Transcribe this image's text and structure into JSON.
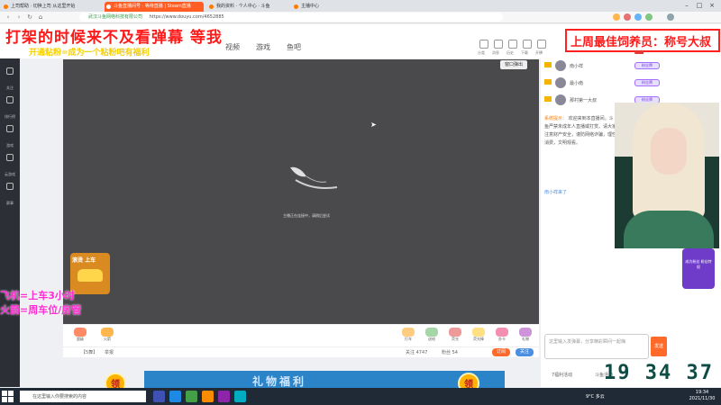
{
  "browser": {
    "tabs": [
      {
        "label": "上司帮助 · 切换上司 从这里开始",
        "active": false
      },
      {
        "label": "斗鱼直播间号 · 等待直播 | Steam直播",
        "active": true
      },
      {
        "label": "我的资料 · 个人中心 · 斗鱼",
        "active": false
      },
      {
        "label": "主播中心",
        "active": false
      }
    ],
    "url_secure_label": "武汉斗鱼网络科技有限公司",
    "url": "https://www.douyu.com/4652885"
  },
  "overlay": {
    "banner_main": "打架的时候来不及看弹幕 等我",
    "banner_sub": "开通粘粉=成为一个粘粉吧有福利",
    "top_right": "上周最佳饲养员：称号大叔",
    "side_line1": "飞机=上车3小时",
    "side_line2": "火箭=周车位/房管"
  },
  "site": {
    "nav": [
      "视频",
      "游戏",
      "鱼吧"
    ],
    "header_icons": [
      "分类",
      "消息",
      "历史",
      "下载",
      "开播"
    ]
  },
  "sidebar": {
    "items": [
      "关注",
      "排行榜",
      "游戏",
      "云游戏",
      "赛事"
    ]
  },
  "player": {
    "popout_label": "窗口弹出",
    "loading_text": "主播正在连接中，请稍后尝试"
  },
  "promo": {
    "label": "滚烫 上车"
  },
  "gifts": [
    {
      "label": "超级"
    },
    {
      "label": "火箭"
    },
    {
      "label": "打车"
    },
    {
      "label": "送给"
    },
    {
      "label": "荧光"
    },
    {
      "label": "荧光棒"
    },
    {
      "label": "办卡"
    },
    {
      "label": "礼物"
    }
  ],
  "infobar": {
    "room": "【5舞】",
    "report": "举报",
    "follow_count": "关注 4747",
    "fans_count": "粉丝 54",
    "subscribe_label": "订阅",
    "follow_label": "关注"
  },
  "chat": {
    "ranks": [
      {
        "name": "南小祥",
        "badge": "粉丝牌"
      },
      {
        "name": "最小南",
        "badge": "粉丝牌"
      },
      {
        "name": "那村第一大叔",
        "badge": "粉丝牌"
      }
    ],
    "system_label": "系统提示：",
    "system_msg": "欢迎来到本直播间。斗鱼严禁未成年人直播或打赏。请大家注意财产安全，谨防网络诈骗，理性消费，文明观看。",
    "chat_user": "南小祥来了",
    "fan_box": "成为粉丝 粉丝特权",
    "input_placeholder": "这里输入发弹幕，分享精彩瞬间一起嗨",
    "send_label": "发送",
    "clock": "19 34 37",
    "links": [
      "7福利活动",
      "斗鱼活动"
    ]
  },
  "bottom_strip": {
    "text": "礼物福利",
    "coin_label": "领"
  },
  "taskbar": {
    "search_placeholder": "在这里输入你要搜索的内容",
    "weather": "9°C 多云",
    "time": "19:34",
    "date": "2021/11/30"
  },
  "colors": {
    "accent": "#ff5d23",
    "banner_red": "#ff1a1a",
    "banner_yellow": "#f6d000",
    "side_pink": "#ff2bd2",
    "player_bg": "#4a4a4c"
  }
}
